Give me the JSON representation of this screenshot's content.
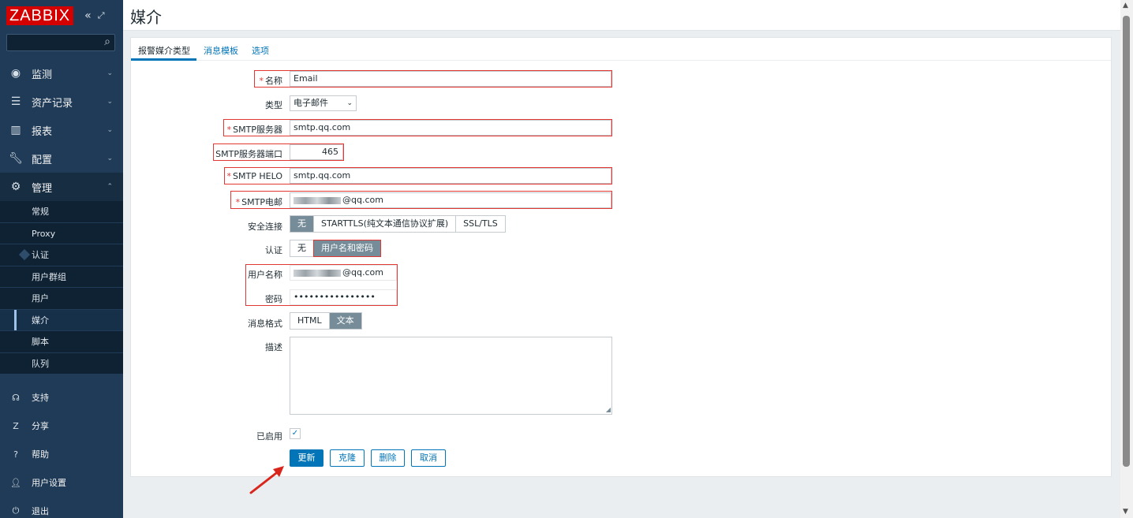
{
  "app": {
    "logo": "ZABBIX",
    "collapse_icon": "«",
    "fullscreen_icon": "⤢"
  },
  "sidebar": {
    "nav": [
      {
        "label": "监测",
        "icon": "eye-icon"
      },
      {
        "label": "资产记录",
        "icon": "list-icon"
      },
      {
        "label": "报表",
        "icon": "bar-chart-icon"
      },
      {
        "label": "配置",
        "icon": "wrench-icon"
      },
      {
        "label": "管理",
        "icon": "gear-icon"
      }
    ],
    "sub_items": [
      "常规",
      "Proxy",
      "认证",
      "用户群组",
      "用户",
      "媒介",
      "脚本",
      "队列"
    ],
    "bottom": [
      {
        "label": "支持",
        "icon": "headset-icon"
      },
      {
        "label": "分享",
        "icon": "share-icon"
      },
      {
        "label": "帮助",
        "icon": "help-icon"
      },
      {
        "label": "用户设置",
        "icon": "user-icon"
      },
      {
        "label": "退出",
        "icon": "power-icon"
      }
    ]
  },
  "header": {
    "title": "媒介"
  },
  "tabs": [
    "报警媒介类型",
    "消息模板",
    "选项"
  ],
  "form": {
    "name_label": "名称",
    "name_value": "Email",
    "type_label": "类型",
    "type_value": "电子邮件",
    "smtp_server_label": "SMTP服务器",
    "smtp_server_value": "smtp.qq.com",
    "smtp_port_label": "SMTP服务器端口",
    "smtp_port_value": "465",
    "smtp_helo_label": "SMTP HELO",
    "smtp_helo_value": "smtp.qq.com",
    "smtp_email_label": "SMTP电邮",
    "smtp_email_suffix": "@qq.com",
    "security_label": "安全连接",
    "security_options": [
      "无",
      "STARTTLS(纯文本通信协议扩展)",
      "SSL/TLS"
    ],
    "auth_label": "认证",
    "auth_options": [
      "无",
      "用户名和密码"
    ],
    "username_label": "用户名称",
    "username_suffix": "@qq.com",
    "password_label": "密码",
    "password_value": "••••••••••••••••",
    "format_label": "消息格式",
    "format_options": [
      "HTML",
      "文本"
    ],
    "description_label": "描述",
    "enabled_label": "已启用"
  },
  "buttons": {
    "update": "更新",
    "clone": "克隆",
    "delete": "删除",
    "cancel": "取消"
  },
  "colors": {
    "sidebar": "#1f3b57",
    "accent": "#0275b8",
    "required": "#e33734",
    "annotation": "#e33734"
  }
}
